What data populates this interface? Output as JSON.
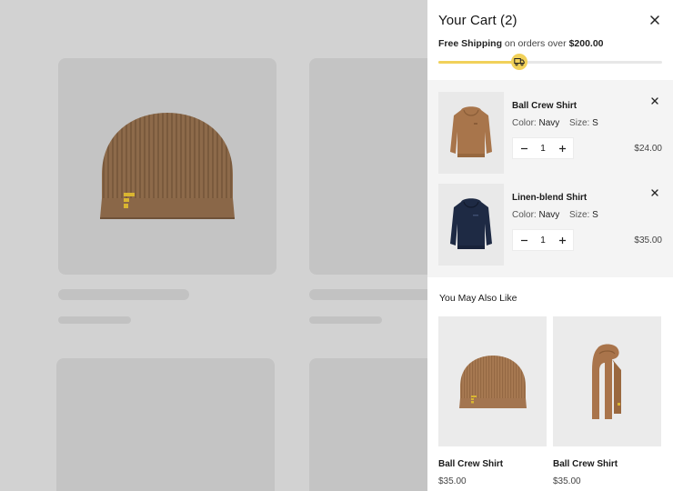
{
  "cart": {
    "title": "Your Cart (2)",
    "close_icon": "close-icon"
  },
  "shipping": {
    "label_bold": "Free Shipping",
    "label_mid": " on orders over ",
    "threshold": "$200.00",
    "progress_fraction": 0.36,
    "icon": "truck-icon",
    "colors": {
      "fill": "#f1d15a",
      "track": "#e7e7e7"
    }
  },
  "items": [
    {
      "name": "Ball Crew Shirt",
      "color_label": "Color:",
      "color_value": "Navy",
      "size_label": "Size:",
      "size_value": "S",
      "qty": "1",
      "price": "$24.00",
      "image": "brown-hoodie"
    },
    {
      "name": "Linen-blend Shirt",
      "color_label": "Color:",
      "color_value": "Navy",
      "size_label": "Size:",
      "size_value": "S",
      "qty": "1",
      "price": "$35.00",
      "image": "navy-hoodie"
    }
  ],
  "recommendations": {
    "title": "You May Also Like",
    "items": [
      {
        "name": "Ball Crew Shirt",
        "price": "$35.00",
        "image": "beanie"
      },
      {
        "name": "Ball Crew Shirt",
        "price": "$35.00",
        "image": "scarf"
      }
    ]
  }
}
